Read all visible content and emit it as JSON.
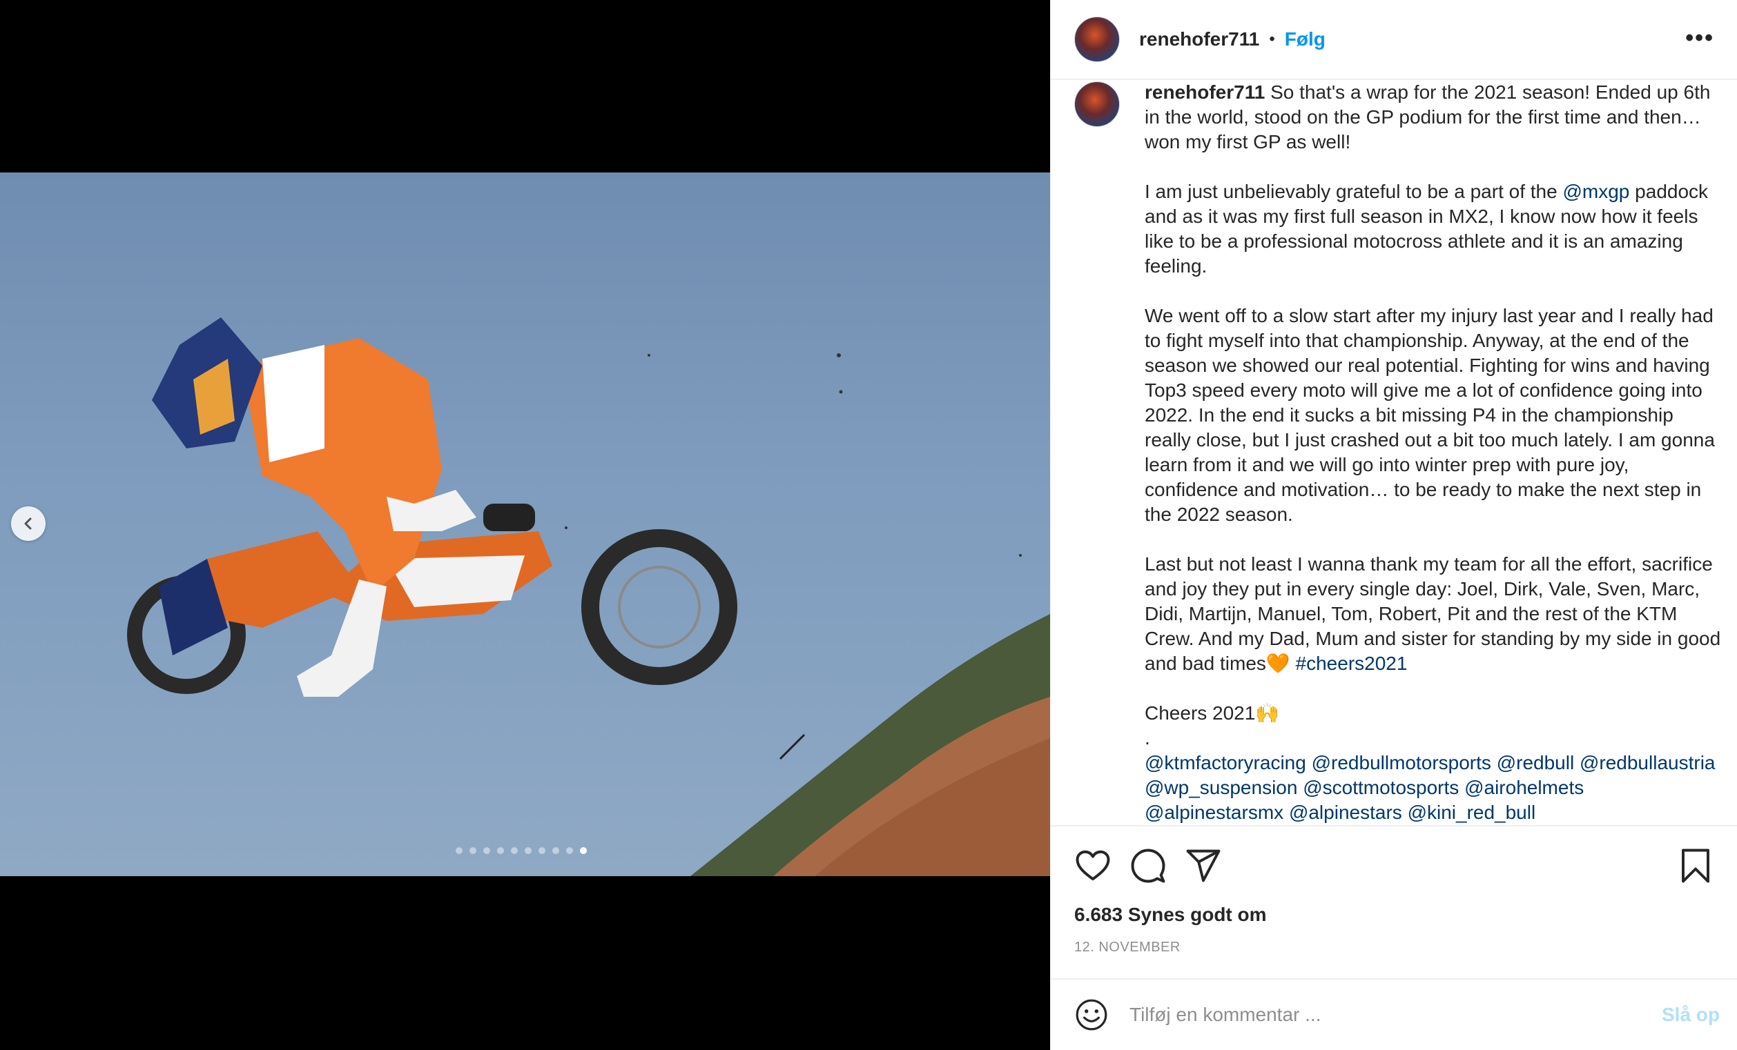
{
  "carousel": {
    "slide_count": 10,
    "active_index": 9
  },
  "header": {
    "username": "renehofer711",
    "separator": "•",
    "follow_label": "Følg",
    "more_label": "•••"
  },
  "caption": {
    "username": "renehofer711",
    "intro": " So that's a wrap for the 2021 season! Ended up 6th in the world, stood on the GP podium for the first time and then… won my first GP as well!",
    "p2_before": "I am just unbelievably grateful to be a part of the ",
    "p2_tag": "@mxgp",
    "p2_after": " paddock and as it was my first full season in MX2, I know now how it feels like to be a professional motocross athlete and it is an amazing feeling.",
    "p3": "We went off to a slow start after my injury last year and I really had to fight myself into that championship. Anyway, at the end of the season we showed our real potential. Fighting for wins and having Top3 speed every moto will give me a lot of confidence going into 2022. In the end it sucks a bit missing P4 in the championship really close, but I just crashed out a bit too much lately. I am gonna learn from it and we will go into winter prep with pure joy, confidence and motivation… to be ready to make the next step in the 2022 season.",
    "p4": "Last but not least I wanna thank my team for all the effort, sacrifice and joy they put in every single day: Joel, Dirk, Vale, Sven, Marc, Didi, Martijn, Manuel, Tom, Robert, Pit and the rest of the KTM Crew. And my Dad, Mum and sister for standing by my side in good and bad times🧡 ",
    "p4_tag": "#cheers2021",
    "p5": "Cheers 2021🙌",
    "dot": ".",
    "mentions": [
      "@ktmfactoryracing",
      "@redbullmotorsports",
      "@redbull",
      "@redbullaustria",
      "@wp_suspension",
      "@scottmotosports",
      "@airohelmets",
      "@alpinestarsmx",
      "@alpinestars",
      "@kini_red_bull"
    ]
  },
  "stats": {
    "likes": "6.683 Synes godt om",
    "date": "12. NOVEMBER"
  },
  "comment": {
    "placeholder": "Tilføj en kommentar ...",
    "post_label": "Slå op"
  },
  "icons": {
    "like": "heart-icon",
    "comment": "comment-icon",
    "share": "send-icon",
    "save": "bookmark-icon",
    "emoji": "smiley-icon",
    "prev": "chevron-left-icon"
  },
  "colors": {
    "accent": "#0095f6",
    "link": "#00376b",
    "muted": "#8e8e8e",
    "post_disabled": "#b2dffc"
  }
}
